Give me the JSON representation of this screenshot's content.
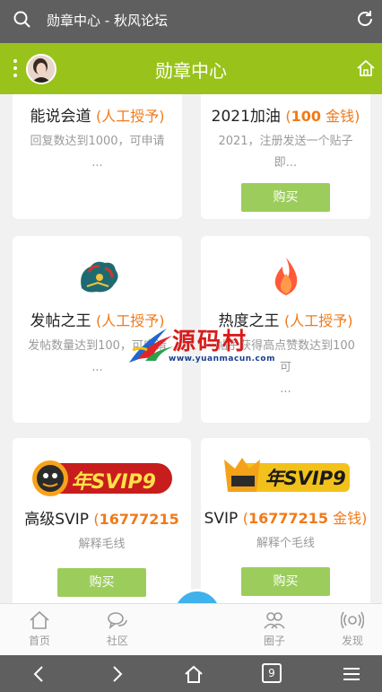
{
  "browser": {
    "title": "勋章中心 - 秋风论坛",
    "tab_count": "9"
  },
  "header": {
    "title": "勋章中心"
  },
  "medals": [
    {
      "name": "能说会道",
      "tag": "人工授予",
      "desc": "回复数达到1000，可申请",
      "more": "..."
    },
    {
      "name": "2021加油",
      "tag_prefix": "",
      "tag_num": "100",
      "tag_unit": "金钱",
      "desc": "2021，注册发送一个贴子",
      "more": "即...",
      "button": "购买"
    },
    {
      "name": "发帖之王",
      "tag": "人工授予",
      "desc": "发帖数量达到100，可申请",
      "more": "..."
    },
    {
      "name": "热度之王",
      "tag": "人工授予",
      "desc": "帖子获得高点赞数达到100可",
      "more": "..."
    },
    {
      "name": "高级SVIP",
      "tag_num": "16777215",
      "desc": "解释毛线",
      "button": "购买",
      "badge_text": "年SVIP9"
    },
    {
      "name": "SVIP",
      "tag_num": "16777215",
      "tag_unit": "金钱",
      "desc": "解释个毛线",
      "button": "购买",
      "badge_text": "年SVIP9"
    }
  ],
  "tabs": [
    {
      "label": "首页"
    },
    {
      "label": "社区"
    },
    {
      "label": "圈子"
    },
    {
      "label": "发现"
    }
  ],
  "watermark": {
    "title": "源码村",
    "url": "www.yuanmacun.com"
  },
  "colors": {
    "header": "#99c31b",
    "accent": "#f07a1a",
    "button": "#9ccd5c",
    "fab": "#3fb2ec"
  }
}
